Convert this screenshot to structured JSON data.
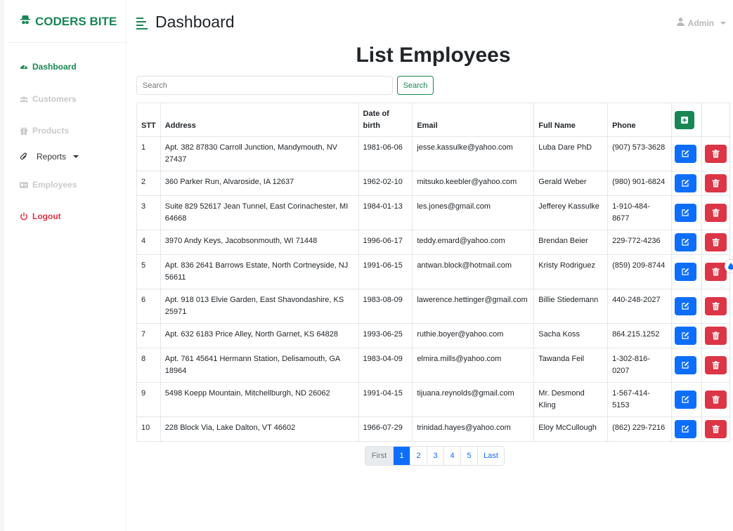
{
  "brand": {
    "name": "CODERS BITE"
  },
  "sidebar": {
    "items": [
      {
        "label": "Dashboard"
      },
      {
        "label": "Customers"
      },
      {
        "label": "Products"
      },
      {
        "label": "Reports"
      },
      {
        "label": "Employees"
      },
      {
        "label": "Logout"
      }
    ]
  },
  "header": {
    "title": "Dashboard",
    "user": "Admin"
  },
  "main": {
    "heading": "List Employees",
    "search": {
      "placeholder": "Search",
      "button_label": "Search"
    },
    "table": {
      "columns": [
        "STT",
        "Address",
        "Date of birth",
        "Email",
        "Full Name",
        "Phone"
      ],
      "rows": [
        {
          "stt": "1",
          "address": "Apt. 382 87830 Carroll Junction, Mandymouth, NV 27437",
          "dob": "1981-06-06",
          "email": "jesse.kassulke@yahoo.com",
          "name": "Luba Dare PhD",
          "phone": "(907) 573-3628"
        },
        {
          "stt": "2",
          "address": "360 Parker Run, Alvaroside, IA 12637",
          "dob": "1962-02-10",
          "email": "mitsuko.keebler@yahoo.com",
          "name": "Gerald Weber",
          "phone": "(980) 901-6824"
        },
        {
          "stt": "3",
          "address": "Suite 829 52617 Jean Tunnel, East Corinachester, MI 64668",
          "dob": "1984-01-13",
          "email": "les.jones@gmail.com",
          "name": "Jefferey Kassulke",
          "phone": "1-910-484-8677"
        },
        {
          "stt": "4",
          "address": "3970 Andy Keys, Jacobsonmouth, WI 71448",
          "dob": "1996-06-17",
          "email": "teddy.emard@yahoo.com",
          "name": "Brendan Beier",
          "phone": "229-772-4236"
        },
        {
          "stt": "5",
          "address": "Apt. 836 2641 Barrows Estate, North Cortneyside, NJ 56611",
          "dob": "1991-06-15",
          "email": "antwan.block@hotmail.com",
          "name": "Kristy Rodriguez",
          "phone": "(859) 209-8744"
        },
        {
          "stt": "6",
          "address": "Apt. 918 013 Elvie Garden, East Shavondashire, KS 25971",
          "dob": "1983-08-09",
          "email": "lawerence.hettinger@gmail.com",
          "name": "Billie Stiedemann",
          "phone": "440-248-2027"
        },
        {
          "stt": "7",
          "address": "Apt. 632 6183 Price Alley, North Garnet, KS 64828",
          "dob": "1993-06-25",
          "email": "ruthie.boyer@yahoo.com",
          "name": "Sacha Koss",
          "phone": "864.215.1252"
        },
        {
          "stt": "8",
          "address": "Apt. 761 45641 Hermann Station, Delisamouth, GA 18964",
          "dob": "1983-04-09",
          "email": "elmira.mills@yahoo.com",
          "name": "Tawanda Feil",
          "phone": "1-302-816-0207"
        },
        {
          "stt": "9",
          "address": "5498 Koepp Mountain, Mitchellburgh, ND 26062",
          "dob": "1991-04-15",
          "email": "tijuana.reynolds@gmail.com",
          "name": "Mr. Desmond Kling",
          "phone": "1-567-414-5153"
        },
        {
          "stt": "10",
          "address": "228 Block Via, Lake Dalton, VT 46602",
          "dob": "1966-07-29",
          "email": "trinidad.hayes@yahoo.com",
          "name": "Eloy McCullough",
          "phone": "(862) 229-7216"
        }
      ]
    },
    "pagination": {
      "first": "First",
      "pages": [
        "1",
        "2",
        "3",
        "4",
        "5"
      ],
      "last": "Last",
      "current": "1"
    }
  },
  "colors": {
    "brand": "#198754",
    "primary": "#0d6efd",
    "danger": "#dc3545",
    "muted": "#c7c9cc"
  }
}
